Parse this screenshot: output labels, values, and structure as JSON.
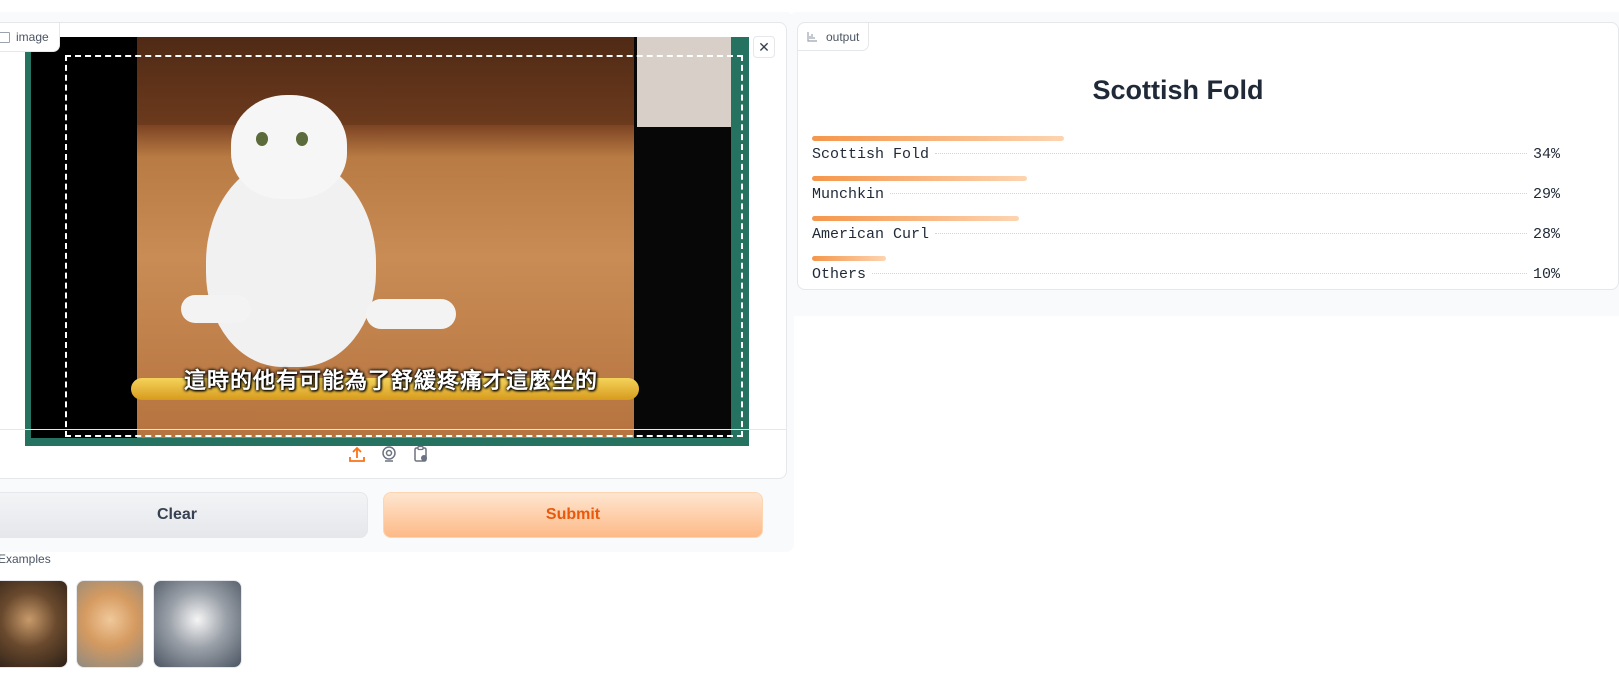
{
  "input": {
    "label": "image",
    "subtitle": "這時的他有可能為了舒緩疼痛才這麼坐的"
  },
  "buttons": {
    "clear": "Clear",
    "submit": "Submit"
  },
  "examples": {
    "label": "Examples"
  },
  "output": {
    "label": "output",
    "title": "Scottish Fold",
    "confidences": [
      {
        "label": "Scottish Fold",
        "value": 0.34,
        "display": "34%"
      },
      {
        "label": "Munchkin",
        "value": 0.29,
        "display": "29%"
      },
      {
        "label": "American Curl",
        "value": 0.28,
        "display": "28%"
      },
      {
        "label": "Others",
        "value": 0.1,
        "display": "10%"
      }
    ]
  },
  "colors": {
    "accent": "#f97316",
    "frame": "#24725f"
  },
  "icons": [
    "image-icon",
    "close-icon",
    "upload-icon",
    "webcam-icon",
    "clipboard-icon",
    "chart-icon"
  ]
}
